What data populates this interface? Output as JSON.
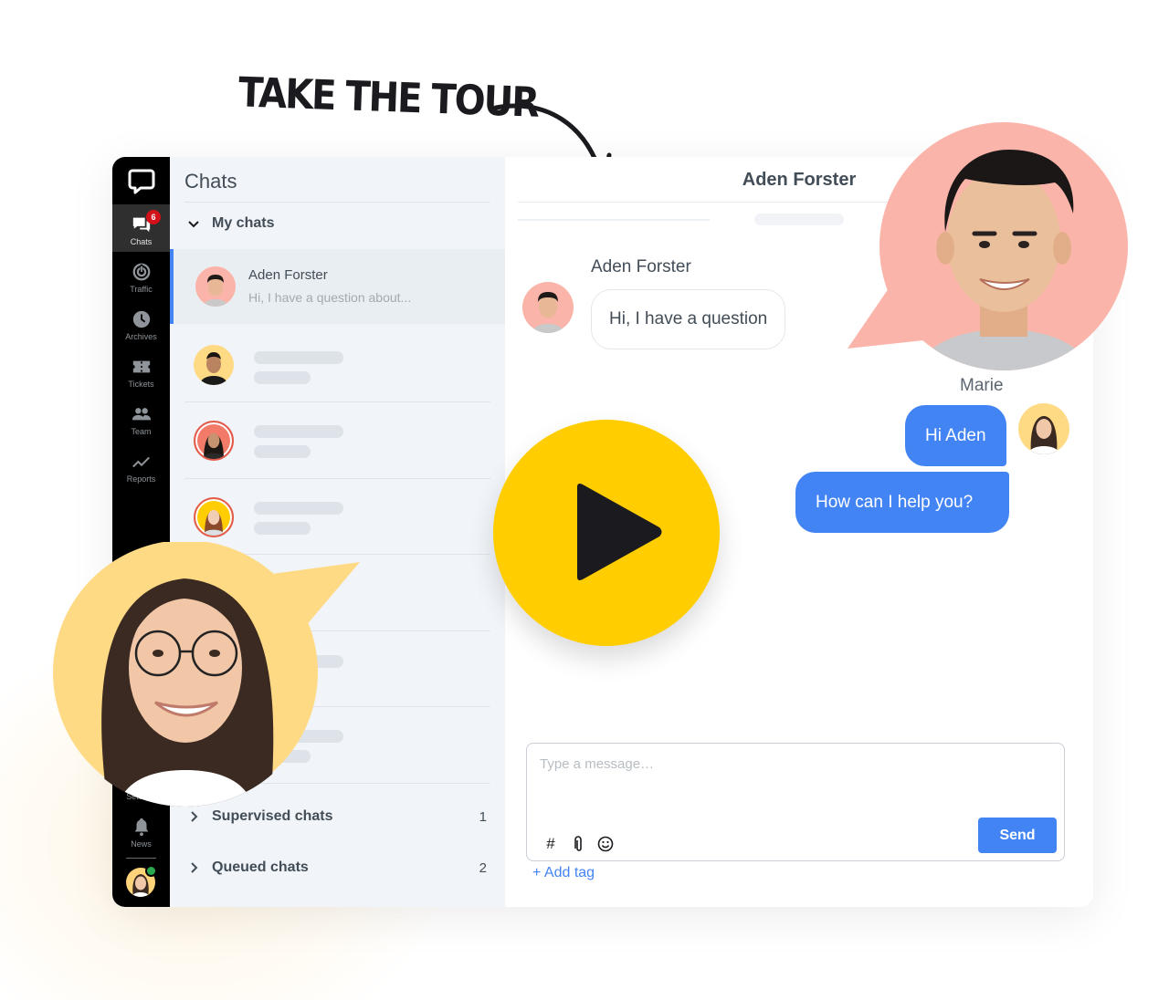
{
  "promo": {
    "heading": "TAKE THE TOUR",
    "play_button_label": "Play video"
  },
  "colors": {
    "accent_blue": "#4384f5",
    "play_yellow": "#ffcd00",
    "agent_bubble": "#ffda85",
    "customer_bubble": "#fbb4aa",
    "badge_red": "#d2111b",
    "online_green": "#2aa84e"
  },
  "navbar": {
    "logo_icon": "livechat-logo-icon",
    "items": [
      {
        "label": "Chats",
        "icon": "chats-icon",
        "badge": "6",
        "active": true
      },
      {
        "label": "Traffic",
        "icon": "traffic-icon"
      },
      {
        "label": "Archives",
        "icon": "clock-icon"
      },
      {
        "label": "Tickets",
        "icon": "ticket-icon"
      },
      {
        "label": "Team",
        "icon": "team-icon"
      },
      {
        "label": "Reports",
        "icon": "reports-icon"
      },
      {
        "label": "Settings",
        "icon": "settings-icon"
      },
      {
        "label": "News",
        "icon": "bell-icon"
      }
    ],
    "user_status": "online"
  },
  "chatlist": {
    "title": "Chats",
    "my_chats": {
      "label": "My chats",
      "expanded": true,
      "items": [
        {
          "name": "Aden Forster",
          "preview": "Hi, I have a question about...",
          "active": true
        }
      ]
    },
    "supervised": {
      "label": "Supervised chats",
      "count": "1"
    },
    "queued": {
      "label": "Queued chats",
      "count": "2"
    }
  },
  "conversation": {
    "title": "Aden Forster",
    "messages": [
      {
        "author": "Aden Forster",
        "text": "Hi, I have a question",
        "direction": "incoming"
      },
      {
        "author": "Marie",
        "text": "Hi Aden",
        "direction": "outgoing"
      },
      {
        "author": "Marie",
        "text": "How can I help you?",
        "direction": "outgoing"
      }
    ],
    "composer": {
      "placeholder": "Type a message…",
      "value": "",
      "send_label": "Send",
      "tools": [
        "hash-icon",
        "paperclip-icon",
        "emoji-icon"
      ],
      "add_tag_label": "+ Add tag"
    }
  }
}
